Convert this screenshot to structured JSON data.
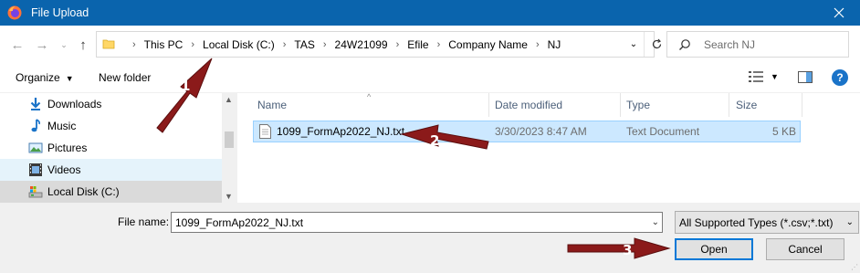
{
  "window": {
    "title": "File Upload",
    "app_icon": "firefox-icon",
    "close_icon": "close-icon"
  },
  "address": {
    "crumbs": [
      "This PC",
      "Local Disk (C:)",
      "TAS",
      "24W21099",
      "Efile",
      "Company Name",
      "NJ"
    ],
    "search_placeholder": "Search NJ"
  },
  "toolbar": {
    "organize_label": "Organize",
    "new_folder_label": "New folder"
  },
  "navpane": {
    "items": [
      {
        "label": "Downloads",
        "icon": "download-arrow-icon"
      },
      {
        "label": "Music",
        "icon": "music-note-icon"
      },
      {
        "label": "Pictures",
        "icon": "pictures-icon"
      },
      {
        "label": "Videos",
        "icon": "videos-icon"
      },
      {
        "label": "Local Disk (C:)",
        "icon": "local-disk-icon"
      }
    ]
  },
  "filelist": {
    "columns": [
      "Name",
      "Date modified",
      "Type",
      "Size"
    ],
    "rows": [
      {
        "name": "1099_FormAp2022_NJ.txt",
        "date": "3/30/2023 8:47 AM",
        "type": "Text Document",
        "size": "5 KB"
      }
    ]
  },
  "bottom": {
    "filename_label": "File name:",
    "filename_value": "1099_FormAp2022_NJ.txt",
    "filetype_value": "All Supported Types (*.csv;*.txt)",
    "open_label": "Open",
    "cancel_label": "Cancel"
  },
  "annotations": {
    "arrow1": "1",
    "arrow2": "2",
    "arrow3": "3"
  },
  "colors": {
    "titlebar": "#0a64ad",
    "selection": "#cce8ff",
    "arrow": "#8b1a1a"
  }
}
